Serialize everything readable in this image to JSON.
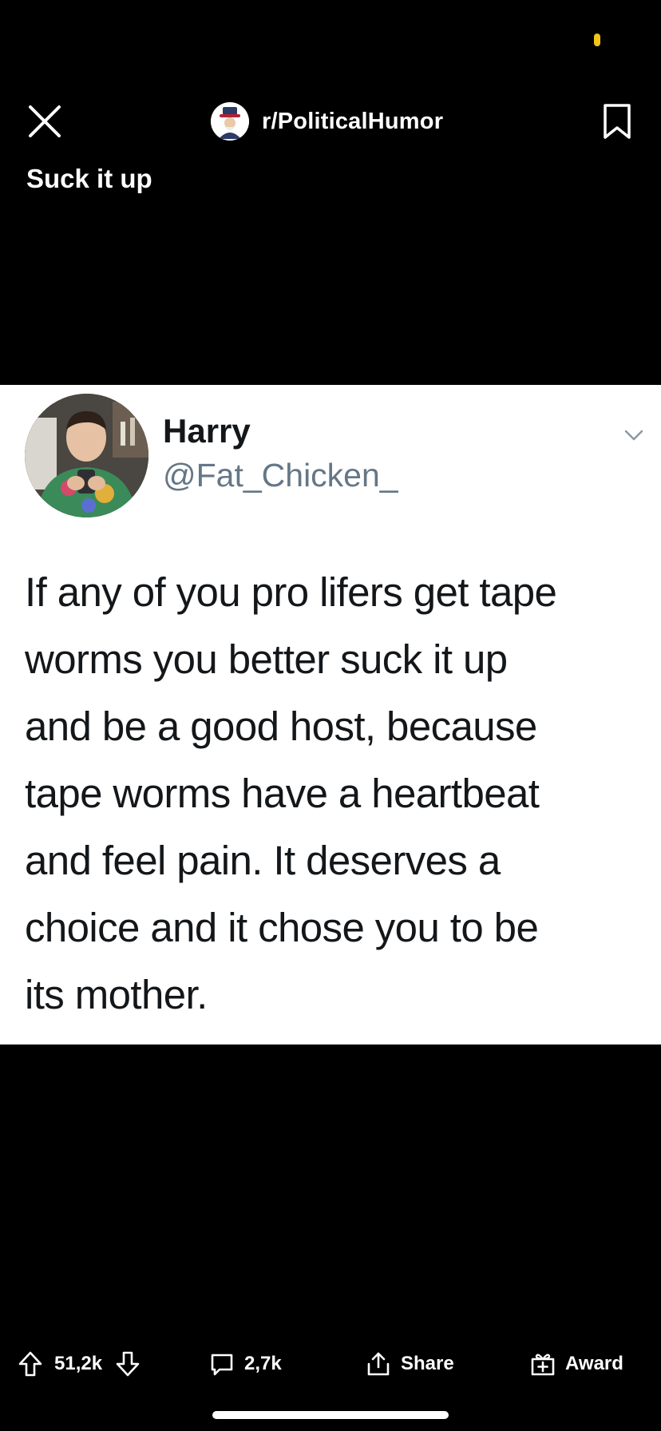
{
  "header": {
    "subreddit": "r/PoliticalHumor"
  },
  "post": {
    "title": "Suck it up"
  },
  "tweet": {
    "name": "Harry",
    "handle": "@Fat_Chicken_",
    "lines": [
      "If any of you pro lifers get tape",
      "worms you better suck it up",
      "and be a good host, because",
      "tape worms have a heartbeat",
      "and feel pain. It deserves a",
      "choice and it chose you to be",
      "its mother."
    ]
  },
  "actions": {
    "score": "51,2k",
    "comments": "2,7k",
    "share": "Share",
    "award": "Award"
  },
  "colors": {
    "background": "#000000",
    "text": "#ffffff",
    "status_dot": "#f0c419",
    "tweet_text": "#14171a",
    "tweet_handle": "#657786"
  },
  "icons": [
    "close-icon",
    "bookmark-icon",
    "upvote-icon",
    "downvote-icon",
    "comment-icon",
    "share-icon",
    "award-icon",
    "chevron-down-icon"
  ]
}
